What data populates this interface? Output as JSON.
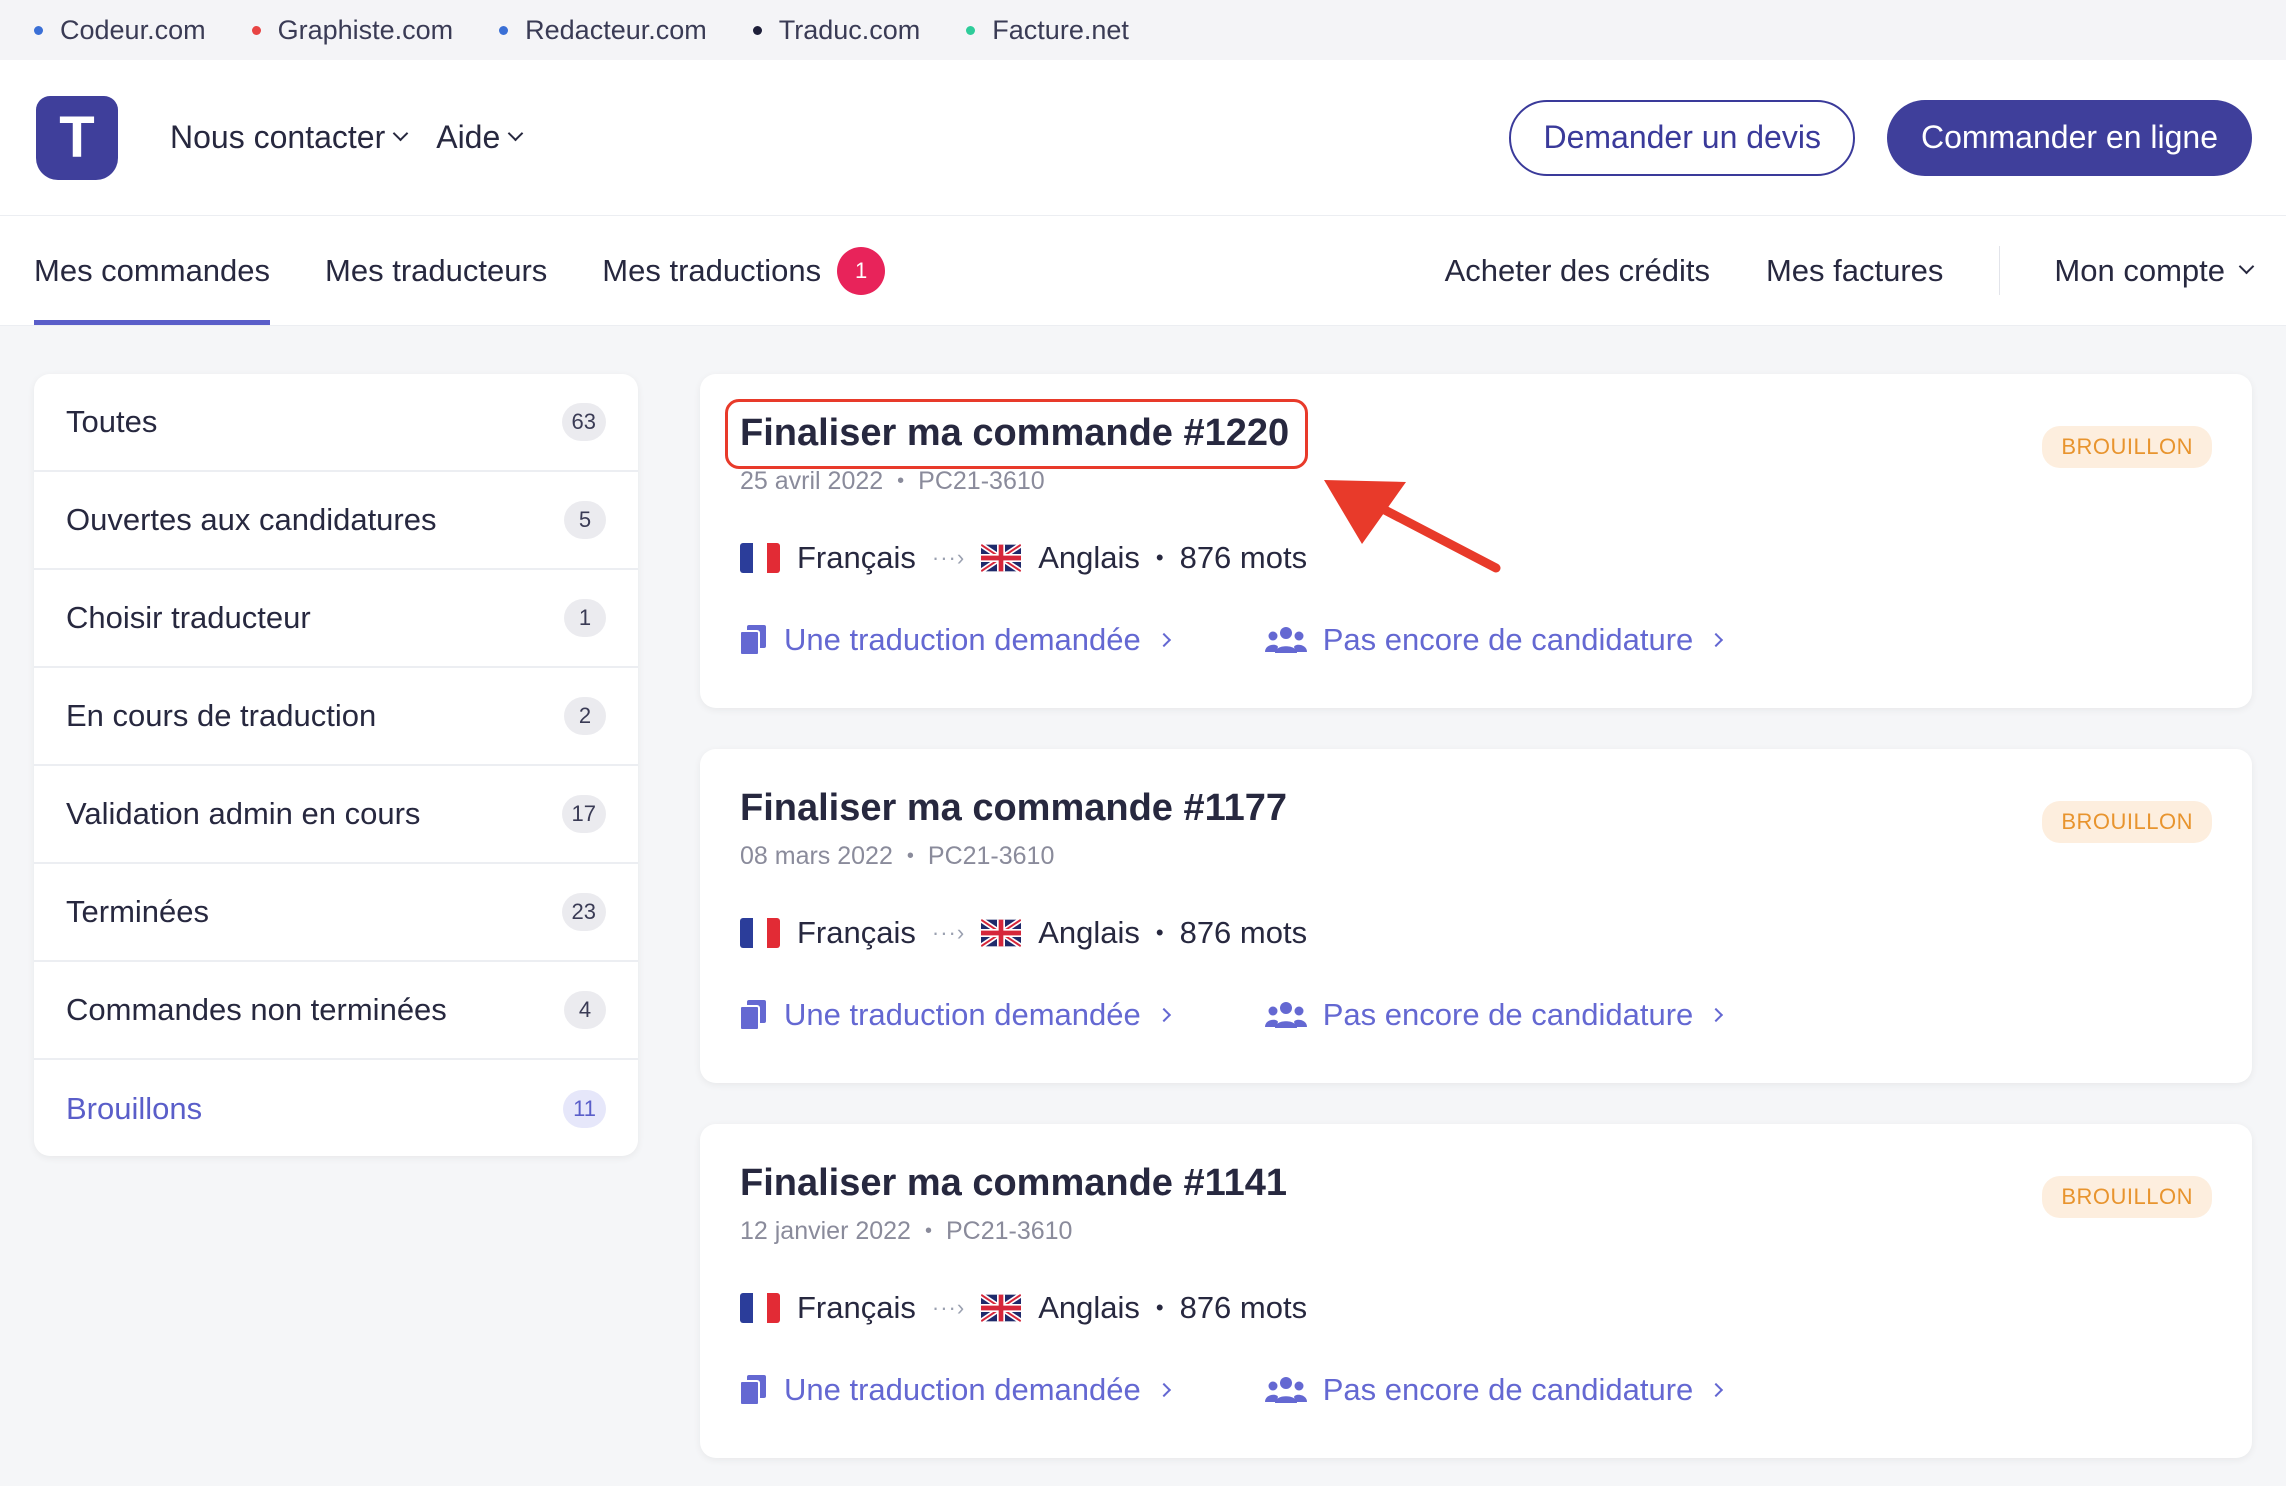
{
  "network": [
    {
      "label": "Codeur.com",
      "color": "#3a6fd6"
    },
    {
      "label": "Graphiste.com",
      "color": "#e84444"
    },
    {
      "label": "Redacteur.com",
      "color": "#3a6fd6"
    },
    {
      "label": "Traduc.com",
      "color": "#1e1f3a"
    },
    {
      "label": "Facture.net",
      "color": "#2ecc9a"
    }
  ],
  "header": {
    "logo_letter": "T",
    "contact_label": "Nous contacter",
    "help_label": "Aide",
    "quote_button": "Demander un devis",
    "order_button": "Commander en ligne"
  },
  "tabs": {
    "orders": "Mes commandes",
    "translators": "Mes traducteurs",
    "translations": "Mes traductions",
    "translations_badge": "1",
    "credits": "Acheter des crédits",
    "invoices": "Mes factures",
    "account": "Mon compte"
  },
  "sidebar": {
    "items": [
      {
        "label": "Toutes",
        "count": "63"
      },
      {
        "label": "Ouvertes aux candidatures",
        "count": "5"
      },
      {
        "label": "Choisir traducteur",
        "count": "1"
      },
      {
        "label": "En cours de traduction",
        "count": "2"
      },
      {
        "label": "Validation admin en cours",
        "count": "17"
      },
      {
        "label": "Terminées",
        "count": "23"
      },
      {
        "label": "Commandes non terminées",
        "count": "4"
      },
      {
        "label": "Brouillons",
        "count": "11"
      }
    ]
  },
  "orders": [
    {
      "title": "Finaliser ma commande #1220",
      "date": "25 avril 2022",
      "ref": "PC21-3610",
      "status": "BROUILLON",
      "source_lang": "Français",
      "target_lang": "Anglais",
      "words": "876 mots",
      "translation_link": "Une traduction demandée",
      "candidates_link": "Pas encore de candidature"
    },
    {
      "title": "Finaliser ma commande #1177",
      "date": "08 mars 2022",
      "ref": "PC21-3610",
      "status": "BROUILLON",
      "source_lang": "Français",
      "target_lang": "Anglais",
      "words": "876 mots",
      "translation_link": "Une traduction demandée",
      "candidates_link": "Pas encore de candidature"
    },
    {
      "title": "Finaliser ma commande #1141",
      "date": "12 janvier 2022",
      "ref": "PC21-3610",
      "status": "BROUILLON",
      "source_lang": "Français",
      "target_lang": "Anglais",
      "words": "876 mots",
      "translation_link": "Une traduction demandée",
      "candidates_link": "Pas encore de candidature"
    }
  ],
  "colors": {
    "brand": "#3f3f9b",
    "accent": "#5a5ec9",
    "link": "#6468d2",
    "badge_red": "#e8235a",
    "draft_bg": "#fdeede",
    "draft_text": "#e8942e",
    "annotation_red": "#e83a2a"
  }
}
